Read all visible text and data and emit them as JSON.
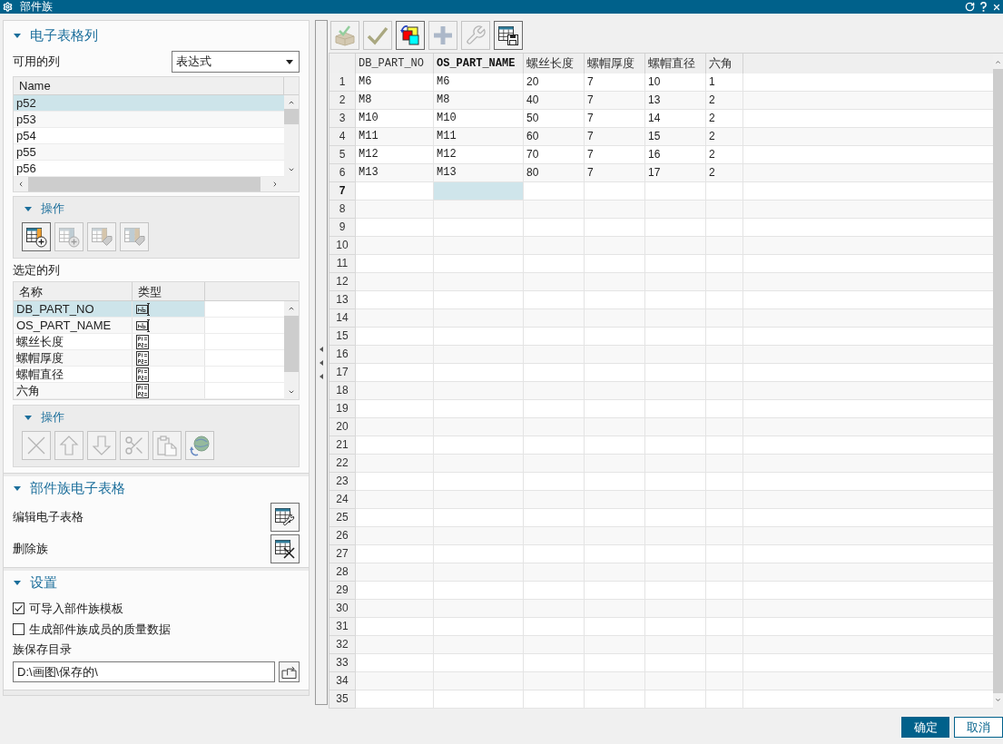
{
  "window": {
    "title": "部件族"
  },
  "spreadsheet_columns": {
    "title": "电子表格列",
    "expanded": true,
    "available_label": "可用的列",
    "filter": {
      "value": "表达式"
    },
    "available_list": {
      "header": "Name",
      "items": [
        {
          "label": "p52",
          "selected": true
        },
        {
          "label": "p53",
          "selected": false
        },
        {
          "label": "p54",
          "selected": false
        },
        {
          "label": "p55",
          "selected": false
        },
        {
          "label": "p56",
          "selected": false
        }
      ]
    },
    "actions": {
      "title": "操作",
      "expanded": true,
      "buttons": [
        {
          "kind": "add-column",
          "disabled": false
        },
        {
          "kind": "add-all",
          "disabled": true
        },
        {
          "kind": "tag",
          "disabled": true
        },
        {
          "kind": "tag-all",
          "disabled": true
        }
      ]
    },
    "selected_label": "选定的列",
    "selected_list": {
      "columns": [
        "名称",
        "类型"
      ],
      "rows": [
        {
          "name": "DB_PART_NO",
          "kind": "text",
          "selected": true
        },
        {
          "name": "OS_PART_NAME",
          "kind": "text",
          "selected": false
        },
        {
          "name": "螺丝长度",
          "kind": "expression",
          "selected": false
        },
        {
          "name": "螺帽厚度",
          "kind": "expression",
          "selected": false
        },
        {
          "name": "螺帽直径",
          "kind": "expression",
          "selected": false
        },
        {
          "name": "六角",
          "kind": "expression",
          "selected": false
        }
      ]
    },
    "list_actions": {
      "title": "操作",
      "expanded": true,
      "buttons": [
        {
          "kind": "delete",
          "disabled": true
        },
        {
          "kind": "move-up",
          "disabled": true
        },
        {
          "kind": "move-down",
          "disabled": true
        },
        {
          "kind": "cut",
          "disabled": true
        },
        {
          "kind": "paste",
          "disabled": true
        },
        {
          "kind": "refresh",
          "disabled": true
        }
      ]
    }
  },
  "family_spreadsheet": {
    "title": "部件族电子表格",
    "expanded": true,
    "actions": [
      {
        "label": "编辑电子表格",
        "kind": "edit"
      },
      {
        "label": "删除族",
        "kind": "delete"
      }
    ]
  },
  "settings": {
    "title": "设置",
    "expanded": true,
    "options": [
      {
        "label": "可导入部件族模板",
        "checked": true
      },
      {
        "label": "生成部件族成员的质量数据",
        "checked": false
      }
    ],
    "directory": {
      "label": "族保存目录",
      "value": "D:\\画图\\保存的\\"
    }
  },
  "toolbar": [
    {
      "kind": "verify",
      "disabled": true
    },
    {
      "kind": "apply",
      "disabled": true
    },
    {
      "kind": "colors",
      "disabled": false
    },
    {
      "kind": "add",
      "disabled": true
    },
    {
      "kind": "edit",
      "disabled": true
    },
    {
      "kind": "save",
      "disabled": false
    }
  ],
  "spreadsheet": {
    "columns": [
      {
        "label": "DB_PART_NO",
        "kind": "text",
        "selected": false
      },
      {
        "label": "OS_PART_NAME",
        "kind": "text",
        "selected": true
      },
      {
        "label": "螺丝长度",
        "kind": "number",
        "selected": false
      },
      {
        "label": "螺帽厚度",
        "kind": "number",
        "selected": false
      },
      {
        "label": "螺帽直径",
        "kind": "number",
        "selected": false
      },
      {
        "label": "六角",
        "kind": "number",
        "selected": false
      }
    ],
    "rows": [
      {
        "number": "1",
        "selected": false,
        "cells": [
          "M6",
          "M6",
          "20",
          "7",
          "10",
          "1"
        ]
      },
      {
        "number": "2",
        "selected": false,
        "cells": [
          "M8",
          "M8",
          "40",
          "7",
          "13",
          "2"
        ]
      },
      {
        "number": "3",
        "selected": false,
        "cells": [
          "M10",
          "M10",
          "50",
          "7",
          "14",
          "2"
        ]
      },
      {
        "number": "4",
        "selected": false,
        "cells": [
          "M11",
          "M11",
          "60",
          "7",
          "15",
          "2"
        ]
      },
      {
        "number": "5",
        "selected": false,
        "cells": [
          "M12",
          "M12",
          "70",
          "7",
          "16",
          "2"
        ]
      },
      {
        "number": "6",
        "selected": false,
        "cells": [
          "M13",
          "M13",
          "80",
          "7",
          "17",
          "2"
        ]
      },
      {
        "number": "7",
        "selected": true
      },
      {
        "number": "8",
        "selected": false
      },
      {
        "number": "9",
        "selected": false
      },
      {
        "number": "10",
        "selected": false
      },
      {
        "number": "11",
        "selected": false
      },
      {
        "number": "12",
        "selected": false
      },
      {
        "number": "13",
        "selected": false
      },
      {
        "number": "14",
        "selected": false
      },
      {
        "number": "15",
        "selected": false
      },
      {
        "number": "16",
        "selected": false
      },
      {
        "number": "17",
        "selected": false
      },
      {
        "number": "18",
        "selected": false
      },
      {
        "number": "19",
        "selected": false
      },
      {
        "number": "20",
        "selected": false
      },
      {
        "number": "21",
        "selected": false
      },
      {
        "number": "22",
        "selected": false
      },
      {
        "number": "23",
        "selected": false
      },
      {
        "number": "24",
        "selected": false
      },
      {
        "number": "25",
        "selected": false
      },
      {
        "number": "26",
        "selected": false
      },
      {
        "number": "27",
        "selected": false
      },
      {
        "number": "28",
        "selected": false
      },
      {
        "number": "29",
        "selected": false
      },
      {
        "number": "30",
        "selected": false
      },
      {
        "number": "31",
        "selected": false
      },
      {
        "number": "32",
        "selected": false
      },
      {
        "number": "33",
        "selected": false
      },
      {
        "number": "34",
        "selected": false
      },
      {
        "number": "35",
        "selected": false
      }
    ]
  },
  "dialog_buttons": [
    {
      "label": "确定",
      "kind": "primary"
    },
    {
      "label": "取消",
      "kind": "secondary"
    }
  ]
}
